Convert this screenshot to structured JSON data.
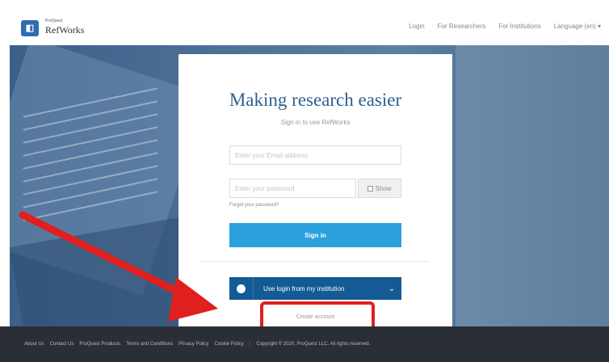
{
  "header": {
    "logo_mark": "▮",
    "logo_sub": "ProQuest",
    "logo_name": "RefWorks",
    "nav": [
      "Login",
      "For Researchers",
      "For Institutions",
      "Language (en) ▾"
    ]
  },
  "card": {
    "title": "Making research easier",
    "subtitle": "Sign in to use RefWorks",
    "email_placeholder": "Enter your Email address",
    "password_placeholder": "Enter your password",
    "show_label": "Show",
    "forgot": "Forgot your password?",
    "signin_label": "Sign in",
    "institution_label": "Use login from my institution",
    "create_account": "Create account"
  },
  "footer": {
    "links": [
      "About Us",
      "Contact Us",
      "ProQuest Products",
      "Terms and Conditions",
      "Privacy Policy",
      "Cookie Policy"
    ],
    "copyright": "Copyright © 2020, ProQuest LLC. All rights reserved."
  },
  "colors": {
    "brand": "#2f5f8f",
    "signin_button": "#2c9fdd",
    "institution_button": "#145a94",
    "annotation": "#e01f1f"
  }
}
